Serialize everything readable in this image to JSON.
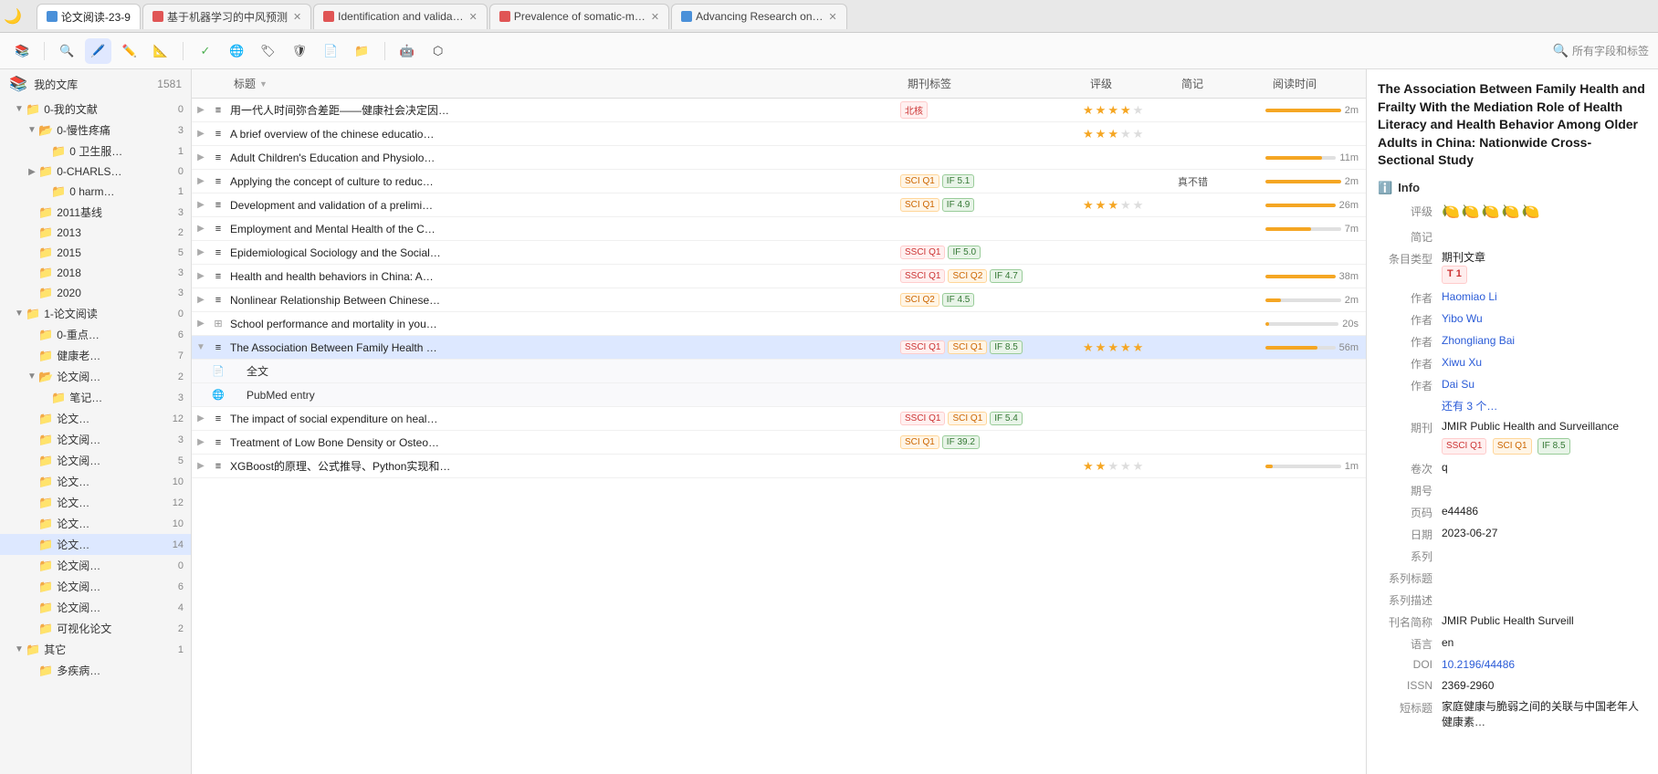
{
  "tabBar": {
    "tabs": [
      {
        "id": "tab1",
        "label": "论文阅读-23-9",
        "active": true,
        "color": "#4a90d9"
      },
      {
        "id": "tab2",
        "label": "基于机器学习的中风预测",
        "active": false,
        "color": "#e05555"
      },
      {
        "id": "tab3",
        "label": "Identification and valida…",
        "active": false,
        "color": "#e05555"
      },
      {
        "id": "tab4",
        "label": "Prevalence of somatic-m…",
        "active": false,
        "color": "#e05555"
      },
      {
        "id": "tab5",
        "label": "Advancing Research on…",
        "active": false,
        "color": "#4a90d9"
      }
    ]
  },
  "toolbar": {
    "buttons": [
      "library",
      "search",
      "highlight",
      "annotate",
      "shapes",
      "check",
      "globe",
      "tag",
      "shield",
      "file",
      "folder",
      "ai",
      "graph"
    ],
    "searchPlaceholder": "所有字段和标签"
  },
  "sidebar": {
    "rootLabel": "我的文库",
    "rootCount": "1581",
    "items": [
      {
        "id": "0-wdc",
        "label": "0-我的文献",
        "count": "0",
        "level": 1,
        "type": "folder",
        "expanded": true
      },
      {
        "id": "0-manxing",
        "label": "0-慢性疼痛",
        "count": "3",
        "level": 2,
        "type": "folder",
        "expanded": true
      },
      {
        "id": "0-weisheng",
        "label": "0 卫生服…",
        "count": "1",
        "level": 3,
        "type": "folder"
      },
      {
        "id": "0-CHARLS",
        "label": "0-CHARLS…",
        "count": "0",
        "level": 2,
        "type": "folder",
        "expanded": false
      },
      {
        "id": "0-harm",
        "label": "0 harm…",
        "count": "1",
        "level": 3,
        "type": "folder"
      },
      {
        "id": "2011",
        "label": "2011基线",
        "count": "3",
        "level": 2,
        "type": "folder"
      },
      {
        "id": "2013",
        "label": "2013",
        "count": "2",
        "level": 2,
        "type": "folder"
      },
      {
        "id": "2015",
        "label": "2015",
        "count": "5",
        "level": 2,
        "type": "folder"
      },
      {
        "id": "2018",
        "label": "2018",
        "count": "3",
        "level": 2,
        "type": "folder"
      },
      {
        "id": "2020",
        "label": "2020",
        "count": "3",
        "level": 2,
        "type": "folder"
      },
      {
        "id": "1-lunyue",
        "label": "1-论文阅读",
        "count": "0",
        "level": 1,
        "type": "folder",
        "expanded": true
      },
      {
        "id": "0-zhongdian",
        "label": "0-重点…",
        "count": "6",
        "level": 2,
        "type": "folder"
      },
      {
        "id": "jiankang-lao",
        "label": "健康老…",
        "count": "7",
        "level": 2,
        "type": "folder"
      },
      {
        "id": "lunwen-yue1",
        "label": "论文阅…",
        "count": "2",
        "level": 2,
        "type": "folder",
        "expanded": true
      },
      {
        "id": "biji",
        "label": "笔记…",
        "count": "3",
        "level": 3,
        "type": "folder"
      },
      {
        "id": "lunwen1",
        "label": "论文…",
        "count": "12",
        "level": 2,
        "type": "folder"
      },
      {
        "id": "lunwen2",
        "label": "论文阅…",
        "count": "3",
        "level": 2,
        "type": "folder"
      },
      {
        "id": "lunwen3",
        "label": "论文阅…",
        "count": "5",
        "level": 2,
        "type": "folder"
      },
      {
        "id": "lunwen4",
        "label": "论文…",
        "count": "10",
        "level": 2,
        "type": "folder"
      },
      {
        "id": "lunwen5",
        "label": "论文…",
        "count": "12",
        "level": 2,
        "type": "folder"
      },
      {
        "id": "lunwen6",
        "label": "论文…",
        "count": "10",
        "level": 2,
        "type": "folder"
      },
      {
        "id": "lunwen7",
        "label": "论文…",
        "count": "14",
        "level": 2,
        "type": "folder",
        "active": true
      },
      {
        "id": "lunwen8",
        "label": "论文阅…",
        "count": "0",
        "level": 2,
        "type": "folder"
      },
      {
        "id": "lunwen9",
        "label": "论文阅…",
        "count": "6",
        "level": 2,
        "type": "folder"
      },
      {
        "id": "lunwen10",
        "label": "论文阅…",
        "count": "4",
        "level": 2,
        "type": "folder"
      },
      {
        "id": "keshihua",
        "label": "可视化论文",
        "count": "2",
        "level": 2,
        "type": "folder"
      },
      {
        "id": "qita",
        "label": "其它",
        "count": "1",
        "level": 1,
        "type": "folder",
        "expanded": true
      },
      {
        "id": "duosheng",
        "label": "多疾病…",
        "count": "",
        "level": 2,
        "type": "folder"
      }
    ]
  },
  "table": {
    "columns": [
      "标题",
      "期刊标签",
      "评级",
      "简记",
      "阅读时间"
    ],
    "rows": [
      {
        "id": "r1",
        "title": "用一代人时间弥合差距——健康社会决定因…",
        "tags": [
          {
            "text": "北核",
            "type": "beiheng"
          }
        ],
        "stars": 4,
        "note": "",
        "progress": 100,
        "timeLabel": "2m",
        "expanded": false,
        "type": "article"
      },
      {
        "id": "r2",
        "title": "A brief overview of the chinese educatio…",
        "tags": [],
        "stars": 3,
        "note": "",
        "progress": 0,
        "timeLabel": "",
        "expanded": false,
        "type": "article"
      },
      {
        "id": "r3",
        "title": "Adult Children's Education and Physiolo…",
        "tags": [],
        "stars": 0,
        "note": "",
        "progress": 80,
        "timeLabel": "11m",
        "expanded": false,
        "type": "article"
      },
      {
        "id": "r4",
        "title": "Applying the concept of culture to reduc…",
        "tags": [
          {
            "text": "SCI Q1",
            "type": "sci"
          },
          {
            "text": "IF 5.1",
            "type": "if"
          }
        ],
        "stars": 0,
        "note": "真不错",
        "progress": 100,
        "timeLabel": "2m",
        "expanded": false,
        "type": "article"
      },
      {
        "id": "r5",
        "title": "Development and validation of a prelimi…",
        "tags": [
          {
            "text": "SCI Q1",
            "type": "sci"
          },
          {
            "text": "IF 4.9",
            "type": "if"
          }
        ],
        "stars": 3,
        "note": "",
        "progress": 100,
        "timeLabel": "26m",
        "expanded": false,
        "type": "article"
      },
      {
        "id": "r6",
        "title": "Employment and Mental Health of the C…",
        "tags": [],
        "stars": 0,
        "note": "",
        "progress": 60,
        "timeLabel": "7m",
        "expanded": false,
        "type": "article"
      },
      {
        "id": "r7",
        "title": "Epidemiological Sociology and the Social…",
        "tags": [
          {
            "text": "SSCI Q1",
            "type": "ssci"
          },
          {
            "text": "IF 5.0",
            "type": "if"
          }
        ],
        "stars": 0,
        "note": "",
        "progress": 0,
        "timeLabel": "",
        "expanded": false,
        "type": "article"
      },
      {
        "id": "r8",
        "title": "Health and health behaviors in China: A…",
        "tags": [
          {
            "text": "SSCI Q1",
            "type": "ssci"
          },
          {
            "text": "SCI Q2",
            "type": "sci"
          },
          {
            "text": "IF 4.7",
            "type": "if"
          }
        ],
        "stars": 0,
        "note": "",
        "progress": 100,
        "timeLabel": "38m",
        "expanded": false,
        "type": "article"
      },
      {
        "id": "r9",
        "title": "Nonlinear Relationship Between Chinese…",
        "tags": [
          {
            "text": "SCI Q2",
            "type": "sci"
          },
          {
            "text": "IF 4.5",
            "type": "if"
          }
        ],
        "stars": 0,
        "note": "",
        "progress": 20,
        "timeLabel": "2m",
        "expanded": false,
        "type": "article"
      },
      {
        "id": "r10",
        "title": "School performance and mortality in you…",
        "tags": [],
        "stars": 0,
        "note": "",
        "progress": 0,
        "timeLabel": "20s",
        "expanded": false,
        "type": "article"
      },
      {
        "id": "r11",
        "title": "The Association Between Family Health …",
        "tags": [
          {
            "text": "SSCI Q1",
            "type": "ssci"
          },
          {
            "text": "SCI Q1",
            "type": "sci"
          },
          {
            "text": "IF 8.5",
            "type": "if"
          }
        ],
        "stars": 5,
        "note": "",
        "progress": 75,
        "timeLabel": "56m",
        "expanded": true,
        "type": "article",
        "selected": true
      },
      {
        "id": "r11-sub1",
        "title": "全文",
        "tags": [],
        "stars": 0,
        "note": "",
        "progress": 0,
        "timeLabel": "",
        "expanded": false,
        "type": "sub-pdf",
        "isSubRow": true
      },
      {
        "id": "r11-sub2",
        "title": "PubMed entry",
        "tags": [],
        "stars": 0,
        "note": "",
        "progress": 0,
        "timeLabel": "",
        "expanded": false,
        "type": "sub-web",
        "isSubRow": true
      },
      {
        "id": "r12",
        "title": "The impact of social expenditure on heal…",
        "tags": [
          {
            "text": "SSCI Q1",
            "type": "ssci"
          },
          {
            "text": "SCI Q1",
            "type": "sci"
          },
          {
            "text": "IF 5.4",
            "type": "if"
          }
        ],
        "stars": 0,
        "note": "",
        "progress": 0,
        "timeLabel": "",
        "expanded": false,
        "type": "article"
      },
      {
        "id": "r13",
        "title": "Treatment of Low Bone Density or Osteo…",
        "tags": [
          {
            "text": "SCI Q1",
            "type": "sci"
          },
          {
            "text": "IF 39.2",
            "type": "if"
          }
        ],
        "stars": 0,
        "note": "",
        "progress": 0,
        "timeLabel": "",
        "expanded": false,
        "type": "article"
      },
      {
        "id": "r14",
        "title": "XGBoost的原理、公式推导、Python实现和…",
        "tags": [],
        "stars": 2,
        "note": "",
        "progress": 10,
        "timeLabel": "1m",
        "expanded": false,
        "type": "article"
      }
    ]
  },
  "rightPanel": {
    "title": "The Association Between Family Health and Frailty With the Mediation Role of Health Literacy and Health Behavior Among Older Adults in China: Nationwide Cross-Sectional Study",
    "info": {
      "label": "Info",
      "rating": "🍋🍋🍋🍋🍋",
      "note": "",
      "itemType": "期刊文章",
      "t1": "T 1",
      "authors": [
        "Haomiao Li",
        "Yibo Wu",
        "Zhongliang Bai",
        "Xiwu Xu",
        "Dai Su"
      ],
      "moreAuthors": "还有 3 个…",
      "journal": "JMIR Public Health and Surveillance",
      "journalTags": [
        {
          "text": "SSCI Q1",
          "type": "ssci"
        },
        {
          "text": "SCI Q1",
          "type": "sci"
        },
        {
          "text": "IF 8.5",
          "type": "if"
        }
      ],
      "volume": "q",
      "issue": "",
      "pages": "e44486",
      "date": "2023-06-27",
      "series": "",
      "seriesTitle": "",
      "seriesDesc": "",
      "journalAbbr": "JMIR Public Health Surveill",
      "language": "en",
      "doi": "10.2196/44486",
      "issn": "2369-2960",
      "shortTitle": "家庭健康与脆弱之间的关联与中国老年人健康素…"
    }
  }
}
